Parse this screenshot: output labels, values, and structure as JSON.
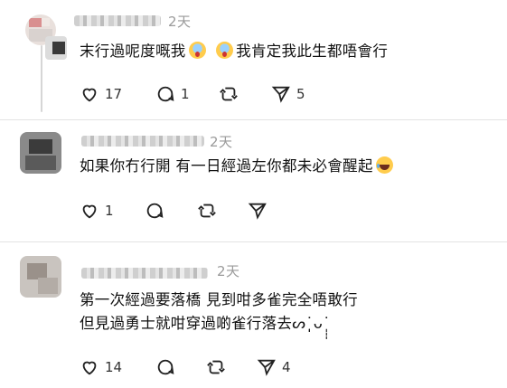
{
  "comments": [
    {
      "time": "2天",
      "text_lines": [
        "末行過呢度嘅我",
        "我肯定我此生都唔會行"
      ],
      "emojis": [
        "scream",
        "scream"
      ],
      "likes": "17",
      "replies": "1",
      "reposts": "",
      "shares": "5"
    },
    {
      "time": "2天",
      "text_lines": [
        "如果你冇行開 有一日經過左你都未必會醒起"
      ],
      "emojis": [
        "laugh"
      ],
      "likes": "1",
      "replies": "",
      "reposts": "",
      "shares": ""
    },
    {
      "time": "2天",
      "text_lines": [
        "第一次經過要落橋 見到咁多雀完全唔敢行",
        "但見過勇士就咁穿過啲雀行落去ᔕ˙̩̩̩ᴗ˙̩̩̩"
      ],
      "emojis": [],
      "likes": "14",
      "replies": "",
      "reposts": "",
      "shares": "4"
    }
  ],
  "icons": {
    "like": "heart-icon",
    "reply": "speech-bubble-icon",
    "repost": "repost-arrows-icon",
    "share": "paper-plane-icon"
  }
}
